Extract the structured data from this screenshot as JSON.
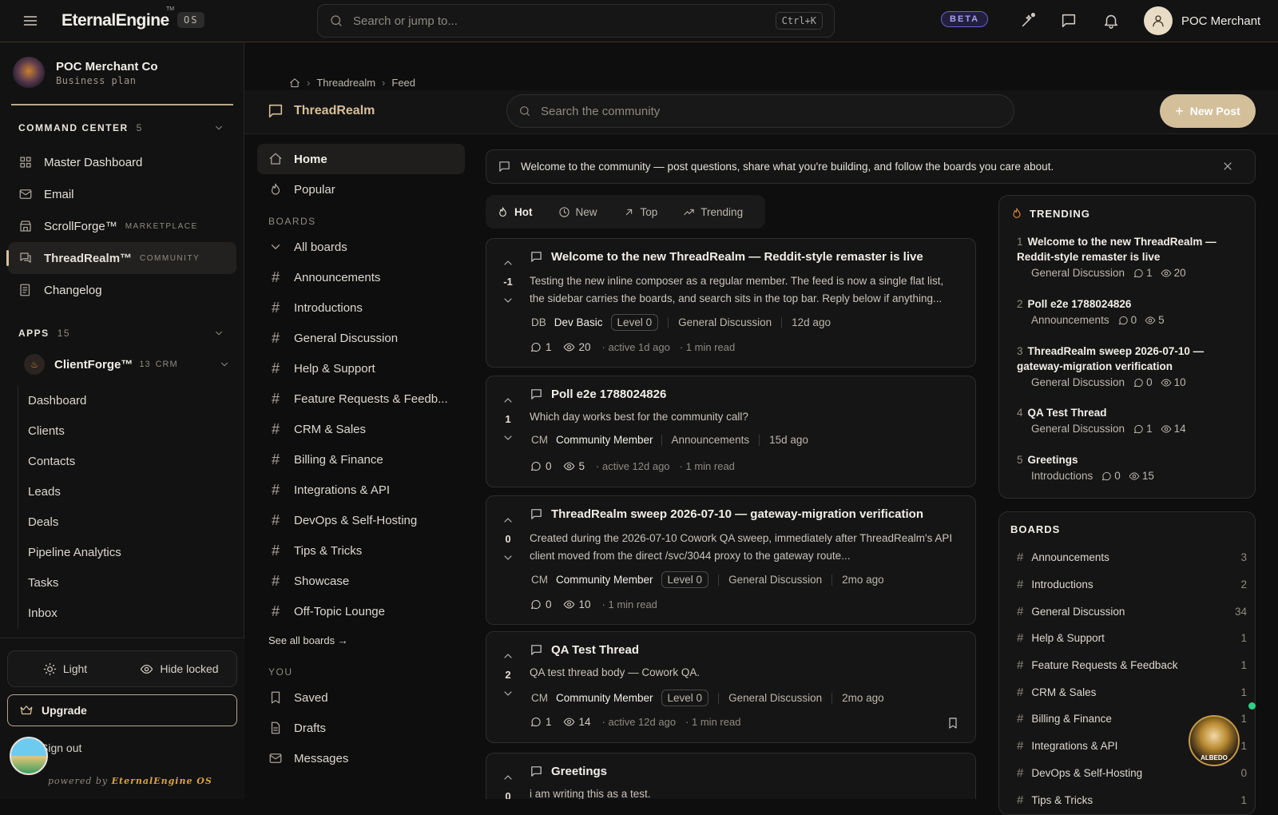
{
  "app": {
    "logo": "EternalEngine",
    "tm": "TM",
    "os_badge": "OS",
    "beta": "BETA",
    "user_name": "POC Merchant"
  },
  "global_search": {
    "placeholder": "Search or jump to...",
    "shortcut": "Ctrl+K"
  },
  "org": {
    "name": "POC Merchant Co",
    "plan": "Business plan"
  },
  "command_center": {
    "title": "COMMAND CENTER",
    "count": "5",
    "items": [
      {
        "label": "Master Dashboard",
        "icon": "grid-icon"
      },
      {
        "label": "Email",
        "icon": "mail-icon"
      },
      {
        "label": "ScrollForge™",
        "tag": "MARKETPLACE",
        "icon": "store-icon"
      },
      {
        "label": "ThreadRealm™",
        "tag": "COMMUNITY",
        "icon": "chat-icon",
        "active": true
      },
      {
        "label": "Changelog",
        "icon": "list-icon"
      }
    ]
  },
  "apps": {
    "title": "APPS",
    "count": "15",
    "clientforge": {
      "name": "ClientForge™",
      "count": "13",
      "tag": "CRM"
    },
    "subitems": [
      "Dashboard",
      "Clients",
      "Contacts",
      "Leads",
      "Deals",
      "Pipeline Analytics",
      "Tasks",
      "Inbox"
    ]
  },
  "bottom": {
    "light": "Light",
    "hide_locked": "Hide locked",
    "upgrade": "Upgrade",
    "sign_out": "Sign out",
    "powered_by": "powered by",
    "powered_brand": "EternalEngine OS"
  },
  "breadcrumb": {
    "items": [
      "Threadrealm",
      "Feed"
    ]
  },
  "threadrealm": {
    "title": "ThreadRealm",
    "search_placeholder": "Search the community",
    "new_post": "New Post"
  },
  "board_nav": {
    "home": "Home",
    "popular": "Popular",
    "boards_head": "BOARDS",
    "all_boards": "All boards",
    "boards": [
      "Announcements",
      "Introductions",
      "General Discussion",
      "Help & Support",
      "Feature Requests & Feedb...",
      "CRM & Sales",
      "Billing & Finance",
      "Integrations & API",
      "DevOps & Self-Hosting",
      "Tips & Tricks",
      "Showcase",
      "Off-Topic Lounge"
    ],
    "see_all": "See all boards →",
    "you_head": "YOU",
    "you": [
      "Saved",
      "Drafts",
      "Messages"
    ]
  },
  "banner": {
    "text": "Welcome to the community — post questions, share what you're building, and follow the boards you care about."
  },
  "sort_tabs": [
    "Hot",
    "New",
    "Top",
    "Trending"
  ],
  "posts": [
    {
      "score": "-1",
      "title": "Welcome to the new ThreadRealm — Reddit-style remaster is live",
      "body": "Testing the new inline composer as a regular member. The feed is now a single flat list, the sidebar carries the boards, and search sits in the top bar. Reply below if anything...",
      "initials": "DB",
      "author": "Dev Basic",
      "level": "Level 0",
      "board": "General Discussion",
      "age": "12d ago",
      "comments": "1",
      "views": "20",
      "active": "· active 1d ago",
      "read": "· 1 min read"
    },
    {
      "score": "1",
      "title": "Poll e2e 1788024826",
      "body": "Which day works best for the community call?",
      "initials": "CM",
      "author": "Community Member",
      "level": "",
      "board": "Announcements",
      "age": "15d ago",
      "comments": "0",
      "views": "5",
      "active": "· active 12d ago",
      "read": "· 1 min read"
    },
    {
      "score": "0",
      "title": "ThreadRealm sweep 2026-07-10 — gateway-migration verification",
      "body": "Created during the 2026-07-10 Cowork QA sweep, immediately after ThreadRealm's API client moved from the direct /svc/3044 proxy to the gateway route...",
      "initials": "CM",
      "author": "Community Member",
      "level": "Level 0",
      "board": "General Discussion",
      "age": "2mo ago",
      "comments": "0",
      "views": "10",
      "active": "",
      "read": "· 1 min read"
    },
    {
      "score": "2",
      "title": "QA Test Thread",
      "body": "QA test thread body — Cowork QA.",
      "initials": "CM",
      "author": "Community Member",
      "level": "Level 0",
      "board": "General Discussion",
      "age": "2mo ago",
      "comments": "1",
      "views": "14",
      "active": "· active 12d ago",
      "read": "· 1 min read"
    },
    {
      "score": "0",
      "title": "Greetings",
      "body": "i am writing this as a test.",
      "initials": "",
      "author": "",
      "level": "",
      "board": "",
      "age": "",
      "comments": "",
      "views": "",
      "active": "",
      "read": ""
    }
  ],
  "trending": {
    "title": "TRENDING",
    "items": [
      {
        "no": "1",
        "title": "Welcome to the new ThreadRealm — Reddit-style remaster is live",
        "board": "General Discussion",
        "comments": "1",
        "views": "20"
      },
      {
        "no": "2",
        "title": "Poll e2e 1788024826",
        "board": "Announcements",
        "comments": "0",
        "views": "5"
      },
      {
        "no": "3",
        "title": "ThreadRealm sweep 2026-07-10 — gateway-migration verification",
        "board": "General Discussion",
        "comments": "0",
        "views": "10"
      },
      {
        "no": "4",
        "title": "QA Test Thread",
        "board": "General Discussion",
        "comments": "1",
        "views": "14"
      },
      {
        "no": "5",
        "title": "Greetings",
        "board": "Introductions",
        "comments": "0",
        "views": "15"
      }
    ]
  },
  "boards_card": {
    "title": "BOARDS",
    "items": [
      {
        "name": "Announcements",
        "count": "3"
      },
      {
        "name": "Introductions",
        "count": "2"
      },
      {
        "name": "General Discussion",
        "count": "34"
      },
      {
        "name": "Help & Support",
        "count": "1"
      },
      {
        "name": "Feature Requests & Feedback",
        "count": "1"
      },
      {
        "name": "CRM & Sales",
        "count": "1"
      },
      {
        "name": "Billing & Finance",
        "count": "1"
      },
      {
        "name": "Integrations & API",
        "count": "1"
      },
      {
        "name": "DevOps & Self-Hosting",
        "count": "0"
      },
      {
        "name": "Tips & Tricks",
        "count": "1"
      }
    ]
  },
  "mascot": {
    "label": "ALBEDO"
  },
  "colors": {
    "accent": "#d6c09a",
    "bg": "#0e0e0e",
    "status_online": "#2fcf86",
    "beta": "#a89ff0"
  }
}
